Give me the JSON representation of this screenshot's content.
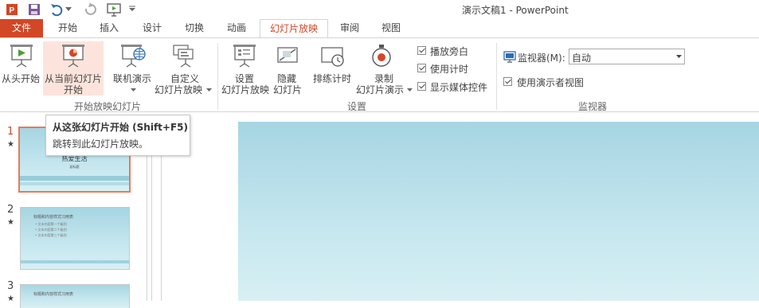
{
  "title": "演示文稿1 - PowerPoint",
  "tabs": [
    {
      "label": "文件"
    },
    {
      "label": "开始"
    },
    {
      "label": "插入"
    },
    {
      "label": "设计"
    },
    {
      "label": "切换"
    },
    {
      "label": "动画"
    },
    {
      "label": "幻灯片放映"
    },
    {
      "label": "审阅"
    },
    {
      "label": "视图"
    }
  ],
  "ribbon": {
    "from_beginning": "从头开始",
    "from_current_1": "从当前幻灯片",
    "from_current_2": "开始",
    "online": "联机演示",
    "custom_1": "自定义",
    "custom_2": "幻灯片放映",
    "group_start": "开始放映幻灯片",
    "setup_1": "设置",
    "setup_2": "幻灯片放映",
    "hide_1": "隐藏",
    "hide_2": "幻灯片",
    "rehearse": "排练计时",
    "record_1": "录制",
    "record_2": "幻灯片演示",
    "chk_narration": "播放旁白",
    "chk_timing": "使用计时",
    "chk_media": "显示媒体控件",
    "group_setup": "设置",
    "monitor_label": "监视器(M):",
    "monitor_value": "自动",
    "presenter_view": "使用演示者视图",
    "group_monitor": "监视器"
  },
  "tooltip": {
    "title": "从这张幻灯片开始 (Shift+F5)",
    "body": "跳转到此幻灯片放映。"
  },
  "slides": [
    {
      "num": "1",
      "star": "★",
      "title": "热爱生活",
      "subtitle": "副标题"
    },
    {
      "num": "2",
      "star": "★",
      "title": "标题和内容样式习用表",
      "bullets": [
        "• 文本内容第一个级别",
        "• 文本内容第二个级别",
        "• 文本内容第三个级别"
      ]
    },
    {
      "num": "3",
      "star": "★",
      "title": "标题和内容样式习用表"
    }
  ]
}
